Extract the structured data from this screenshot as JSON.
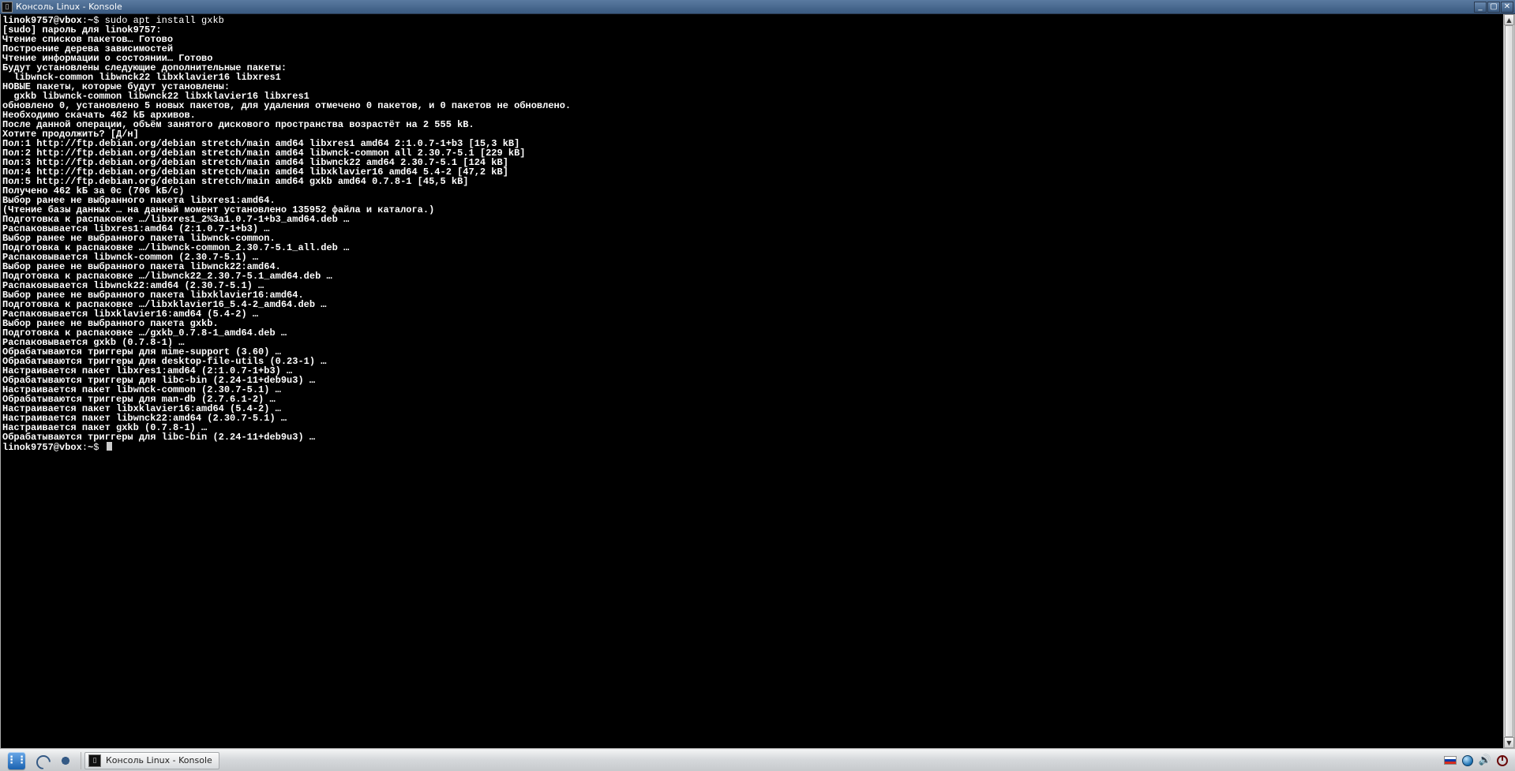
{
  "window": {
    "title": "Консоль Linux - Konsole"
  },
  "terminal": {
    "prompt1_user": "linok9757@vbox",
    "prompt1_sep": ":",
    "prompt1_path": "~",
    "prompt1_sym": "$",
    "command1": " sudo apt install gxkb",
    "lines": [
      "[sudo] пароль для linok9757:",
      "Чтение списков пакетов… Готово",
      "Построение дерева зависимостей",
      "Чтение информации о состоянии… Готово",
      "Будут установлены следующие дополнительные пакеты:",
      "  libwnck-common libwnck22 libxklavier16 libxres1",
      "НОВЫЕ пакеты, которые будут установлены:",
      "  gxkb libwnck-common libwnck22 libxklavier16 libxres1",
      "обновлено 0, установлено 5 новых пакетов, для удаления отмечено 0 пакетов, и 0 пакетов не обновлено.",
      "Необходимо скачать 462 kБ архивов.",
      "После данной операции, объём занятого дискового пространства возрастёт на 2 555 kB.",
      "Хотите продолжить? [Д/н]",
      "Пол:1 http://ftp.debian.org/debian stretch/main amd64 libxres1 amd64 2:1.0.7-1+b3 [15,3 kB]",
      "Пол:2 http://ftp.debian.org/debian stretch/main amd64 libwnck-common all 2.30.7-5.1 [229 kB]",
      "Пол:3 http://ftp.debian.org/debian stretch/main amd64 libwnck22 amd64 2.30.7-5.1 [124 kB]",
      "Пол:4 http://ftp.debian.org/debian stretch/main amd64 libxklavier16 amd64 5.4-2 [47,2 kB]",
      "Пол:5 http://ftp.debian.org/debian stretch/main amd64 gxkb amd64 0.7.8-1 [45,5 kB]",
      "Получено 462 kБ за 0с (706 kБ/c)",
      "Выбор ранее не выбранного пакета libxres1:amd64.",
      "(Чтение базы данных … на данный момент установлено 135952 файла и каталога.)",
      "Подготовка к распаковке …/libxres1_2%3a1.0.7-1+b3_amd64.deb …",
      "Распаковывается libxres1:amd64 (2:1.0.7-1+b3) …",
      "Выбор ранее не выбранного пакета libwnck-common.",
      "Подготовка к распаковке …/libwnck-common_2.30.7-5.1_all.deb …",
      "Распаковывается libwnck-common (2.30.7-5.1) …",
      "Выбор ранее не выбранного пакета libwnck22:amd64.",
      "Подготовка к распаковке …/libwnck22_2.30.7-5.1_amd64.deb …",
      "Распаковывается libwnck22:amd64 (2.30.7-5.1) …",
      "Выбор ранее не выбранного пакета libxklavier16:amd64.",
      "Подготовка к распаковке …/libxklavier16_5.4-2_amd64.deb …",
      "Распаковывается libxklavier16:amd64 (5.4-2) …",
      "Выбор ранее не выбранного пакета gxkb.",
      "Подготовка к распаковке …/gxkb_0.7.8-1_amd64.deb …",
      "Распаковывается gxkb (0.7.8-1) …",
      "Обрабатываются триггеры для mime-support (3.60) …",
      "Обрабатываются триггеры для desktop-file-utils (0.23-1) …",
      "Настраивается пакет libxres1:amd64 (2:1.0.7-1+b3) …",
      "Обрабатываются триггеры для libc-bin (2.24-11+deb9u3) …",
      "Настраивается пакет libwnck-common (2.30.7-5.1) …",
      "Обрабатываются триггеры для man-db (2.7.6.1-2) …",
      "Настраивается пакет libxklavier16:amd64 (5.4-2) …",
      "Настраивается пакет libwnck22:amd64 (2.30.7-5.1) …",
      "Настраивается пакет gxkb (0.7.8-1) …",
      "Обрабатываются триггеры для libc-bin (2.24-11+deb9u3) …"
    ],
    "prompt2_user": "linok9757@vbox",
    "prompt2_sep": ":",
    "prompt2_path": "~",
    "prompt2_sym": "$"
  },
  "taskbar": {
    "task_label": "Консоль Linux - Konsole"
  }
}
